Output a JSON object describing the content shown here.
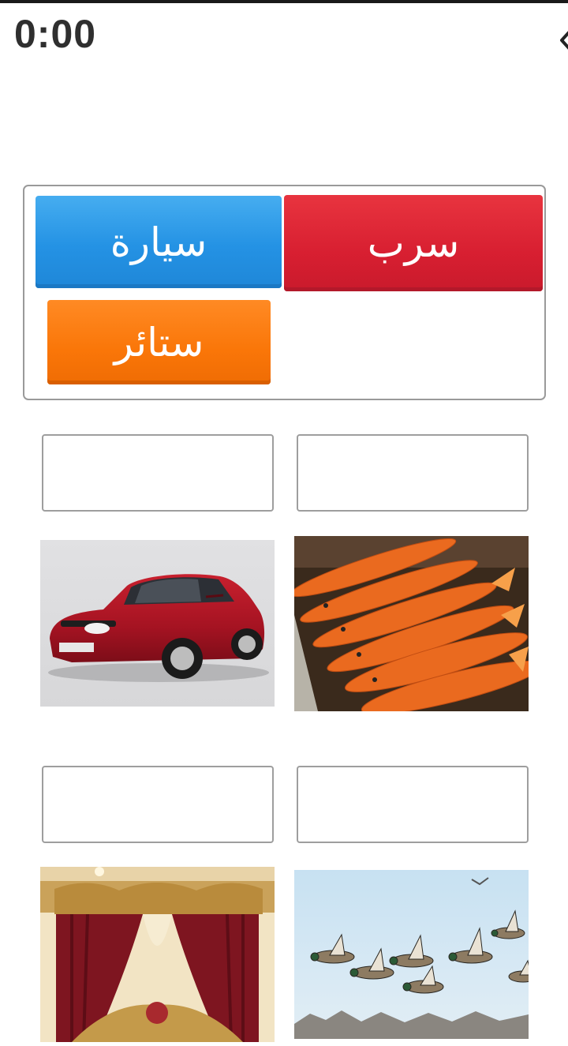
{
  "status": {
    "timer": "0:00"
  },
  "word_bank": {
    "words": [
      {
        "label": "سيارة",
        "color": "#2494e4"
      },
      {
        "label": "سرب",
        "color": "#d81f31"
      },
      {
        "label": "ستائر",
        "color": "#fa7608"
      }
    ]
  },
  "answers": [
    {
      "value": ""
    },
    {
      "value": ""
    },
    {
      "value": ""
    },
    {
      "value": ""
    }
  ],
  "pictures": [
    {
      "icon": "car-image"
    },
    {
      "icon": "fish-image"
    },
    {
      "icon": "curtains-image"
    },
    {
      "icon": "flock-of-birds-image"
    }
  ]
}
